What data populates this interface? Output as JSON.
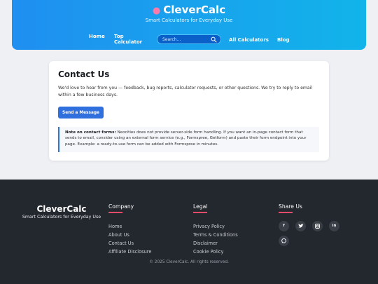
{
  "header": {
    "brand_icon": "brain-icon",
    "brand_name": "CleverCalc",
    "tagline": "Smart Calculators for Everyday Use",
    "nav": {
      "home": "Home",
      "top_calculator_line1": "Top",
      "top_calculator_line2": "Calculator",
      "all_calculators": "All Calculators",
      "blog": "Blog"
    },
    "search": {
      "placeholder": "Search...",
      "value": ""
    }
  },
  "contact": {
    "title": "Contact Us",
    "intro": "We'd love to hear from you — feedback, bug reports, calculator requests, or other questions. We try to reply to email within a few business days.",
    "send_button": "Send a Message",
    "note_label": "Note on contact forms:",
    "note_text": " Neocities does not provide server-side form handling. If you want an in-page contact form that sends to email, consider using an external form service (e.g., Formspree, Getform) and paste their form endpoint into your page. Example: a ready-to-use form can be added with Formspree in minutes."
  },
  "footer": {
    "brand_name": "CleverCalc",
    "tagline": "Smart Calculators for Everyday Use",
    "company": {
      "heading": "Company",
      "links": [
        "Home",
        "About Us",
        "Contact Us",
        "Affiliate Disclosure"
      ]
    },
    "legal": {
      "heading": "Legal",
      "links": [
        "Privacy Policy",
        "Terms & Conditions",
        "Disclaimer",
        "Cookie Policy"
      ]
    },
    "share": {
      "heading": "Share Us",
      "icons": [
        "facebook-icon",
        "twitter-icon",
        "instagram-icon",
        "linkedin-icon",
        "whatsapp-icon"
      ]
    },
    "copyright": "© 2025 CleverCalc. All rights reserved."
  },
  "colors": {
    "header_gradient_start": "#1f8ff0",
    "header_gradient_end": "#12b4ea",
    "accent_blue": "#2f6fde",
    "footer_bg": "#23272e",
    "footer_accent": "#e34b6a"
  }
}
